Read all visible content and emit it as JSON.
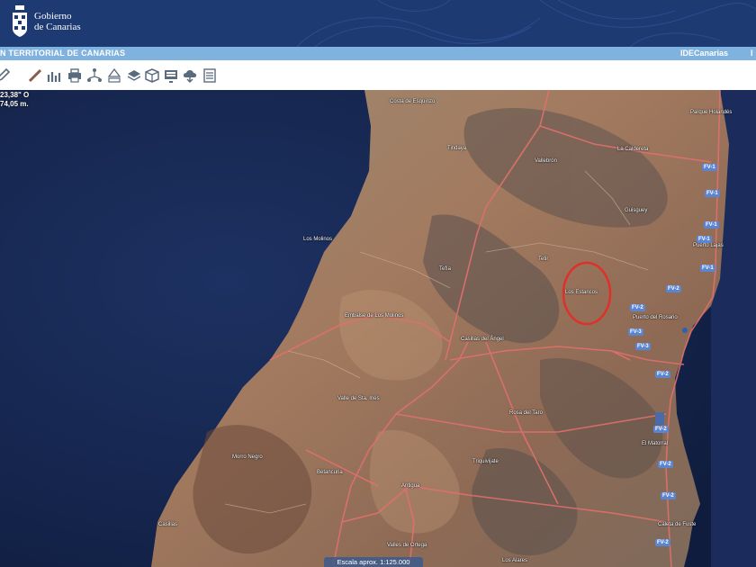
{
  "header": {
    "logo_line1": "Gobierno",
    "logo_line2": "de Canarias"
  },
  "subbar": {
    "left_text": "N TERRITORIAL DE CANARIAS",
    "right_link": "IDECanarias",
    "edge_text": "I"
  },
  "toolbar": {
    "tools": [
      "pencil-icon",
      "ruler-icon",
      "profile-chart-icon",
      "print-icon",
      "network-icon",
      "tree-icon",
      "layers-icon",
      "cube-icon",
      "monitor-icon",
      "cloud-download-icon",
      "document-icon"
    ]
  },
  "coords": {
    "lon": "23,38\" O",
    "alt": "74,05 m."
  },
  "scale": {
    "label": "Escala aprox. 1:125.000"
  },
  "places": {
    "p1": "Costa de Esquinzo",
    "p2": "Tindaya",
    "p3": "Vallebrón",
    "p4": "La Caldereta",
    "p5": "Parque Holandés",
    "p6": "Los Molinos",
    "p7": "Guisguey",
    "p8": "Puerto Lajas",
    "p9": "Tefía",
    "p10": "Tetir",
    "p11": "Los Estancos",
    "p12": "Embalse de Los Molinos",
    "p13": "Puerto del Rosario",
    "p14": "Casillas del Ángel",
    "p15": "Valle de Sta. Inés",
    "p16": "Rosa del Taro",
    "p17": "El Matorral",
    "p18": "Morro Negro",
    "p19": "Betancuria",
    "p20": "Triquivijate",
    "p21": "Antigua",
    "p22": "Caleta de Fuste",
    "p23": "Valles de Ortega",
    "p24": "Los Alares",
    "p25": "Casillas"
  },
  "roads": {
    "r1": "FV-1",
    "r2": "FV-1",
    "r3": "FV-1",
    "r4": "FV-1",
    "r5": "FV-1",
    "r6": "FV-2",
    "r7": "FV-2",
    "r8": "FV-3",
    "r9": "FV-3",
    "r10": "FV-2",
    "r11": "FV-2",
    "r12": "FV-2",
    "r13": "FV-2",
    "r14": "FV-2"
  },
  "highlight": {
    "color": "#e0302a"
  }
}
